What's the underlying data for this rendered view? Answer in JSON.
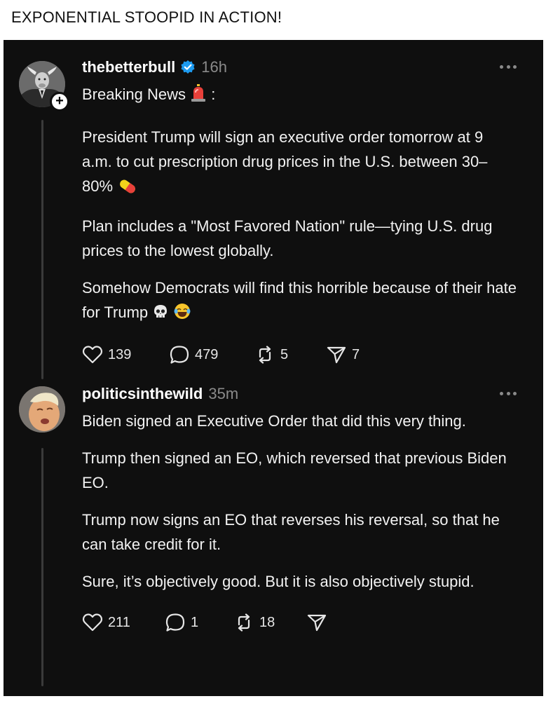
{
  "caption": "EXPONENTIAL STOOPID IN ACTION!",
  "posts": [
    {
      "username": "thebetterbull",
      "time": "16h",
      "follow_badge": "+",
      "headline": "Breaking News",
      "headline_suffix": ":",
      "paragraphs": [
        "President Trump will sign an executive order tomorrow at 9 a.m. to cut prescription drug prices in the U.S. between 30–80%",
        "Plan includes a \"Most Favored Nation\" rule—tying U.S. drug prices to the lowest globally.",
        "Somehow Democrats will find this horrible because of their hate for Trump"
      ],
      "likes": "139",
      "replies": "479",
      "reposts": "5",
      "shares": "7"
    },
    {
      "username": "politicsinthewild",
      "time": "35m",
      "paragraphs": [
        "Biden signed an Executive Order that did this very thing.",
        "Trump then signed an EO, which reversed that previous Biden EO.",
        "Trump now signs an EO that reverses his reversal, so that he can take credit for it.",
        "Sure, it’s objectively good. But it is also objectively stupid."
      ],
      "likes": "211",
      "replies": "1",
      "reposts": "18",
      "shares": ""
    }
  ],
  "colors": {
    "card_bg": "#0f0f0f",
    "text": "#f2f2f2",
    "muted": "#8a8a8a",
    "verified": "#1d9bf0"
  },
  "icons": [
    "verified-icon",
    "more-icon",
    "siren-icon",
    "pill-icon",
    "skull-icon",
    "laughing-emoji-icon",
    "heart-icon",
    "comment-icon",
    "repost-icon",
    "share-icon"
  ]
}
